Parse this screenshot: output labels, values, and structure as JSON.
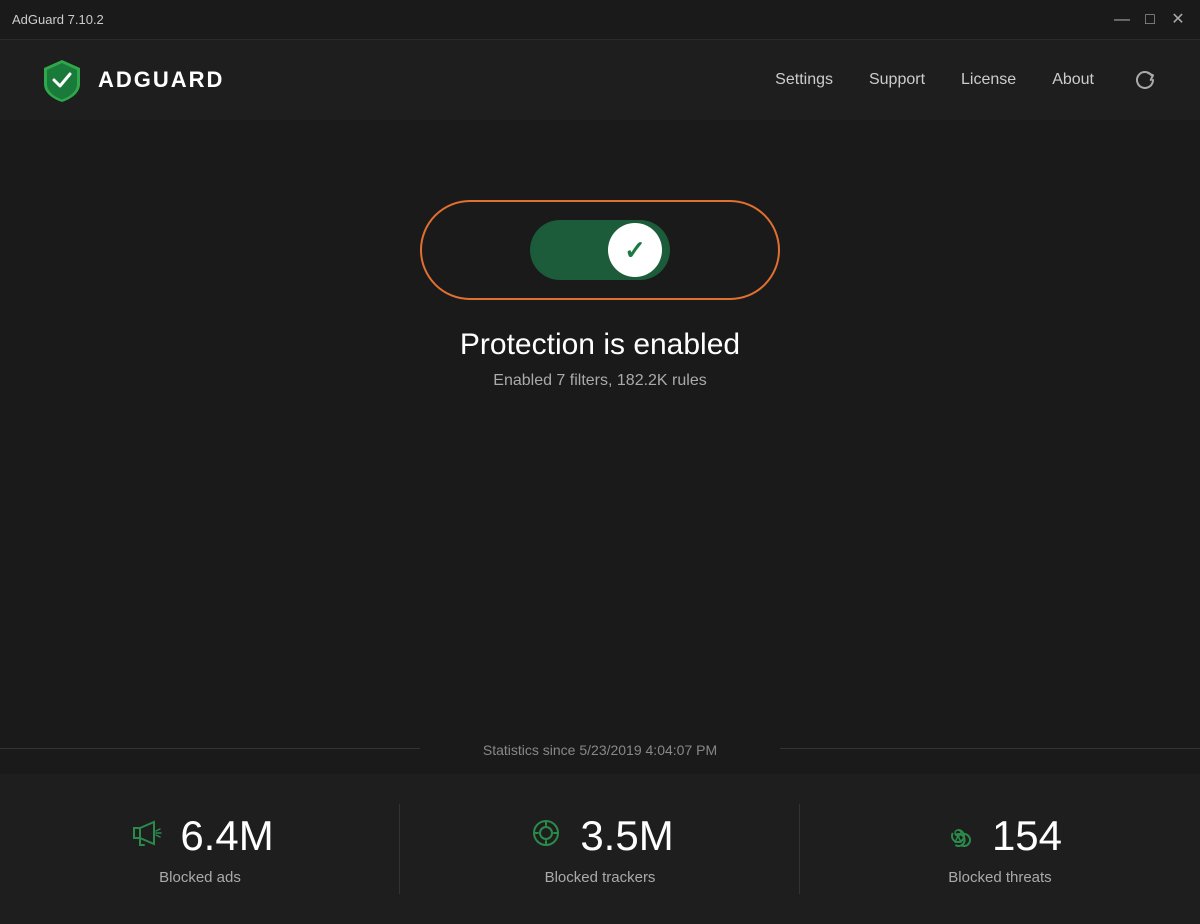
{
  "titleBar": {
    "title": "AdGuard 7.10.2",
    "minimize": "—",
    "maximize": "□",
    "close": "✕"
  },
  "header": {
    "logoText": "ADGUARD",
    "nav": {
      "settings": "Settings",
      "support": "Support",
      "license": "License",
      "about": "About"
    }
  },
  "protection": {
    "status": "Protection is enabled",
    "detail": "Enabled 7 filters, 182.2K rules"
  },
  "stats": {
    "since": "Statistics since 5/23/2019 4:04:07 PM",
    "blockedAds": {
      "value": "6.4M",
      "label": "Blocked ads"
    },
    "blockedTrackers": {
      "value": "3.5M",
      "label": "Blocked trackers"
    },
    "blockedThreats": {
      "value": "154",
      "label": "Blocked threats"
    }
  }
}
